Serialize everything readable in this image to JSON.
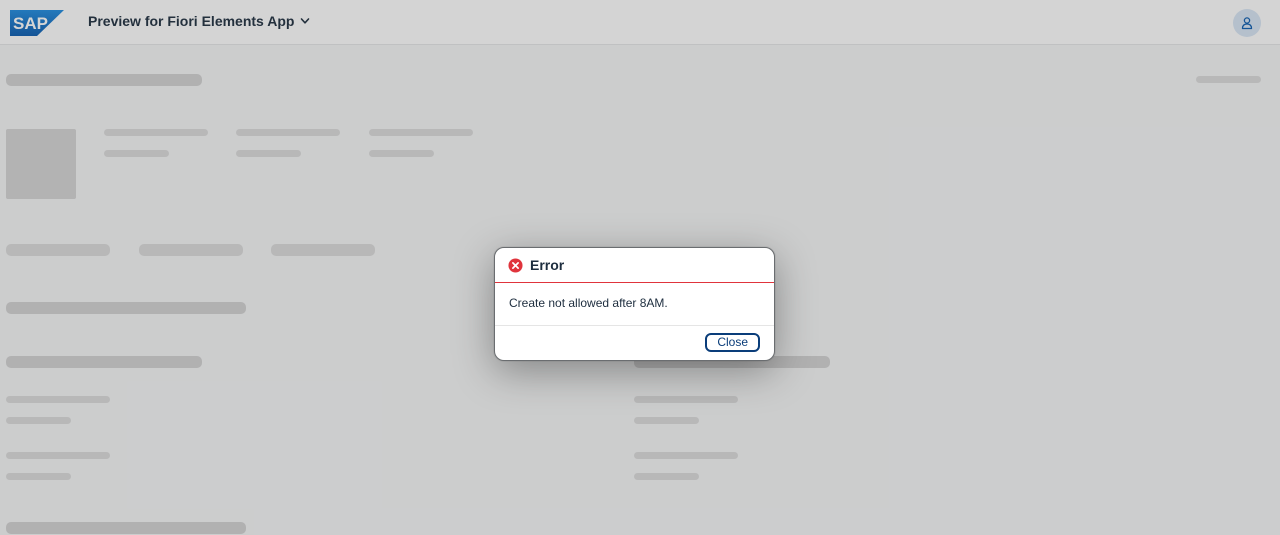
{
  "shell": {
    "logo_text": "SAP",
    "app_title": "Preview for Fiori Elements App"
  },
  "dialog": {
    "title": "Error",
    "message": "Create not allowed after 8AM.",
    "close_label": "Close"
  },
  "colors": {
    "logo_blue": "#1a73c7",
    "error_red": "#e0343c",
    "button_border": "#0a3d7a",
    "skeleton": "#dcdcdc",
    "overlay": "rgba(60,60,60,0.22)"
  },
  "icons": {
    "title_dropdown": "chevron-down-icon",
    "user": "user-icon",
    "error": "error-icon"
  }
}
